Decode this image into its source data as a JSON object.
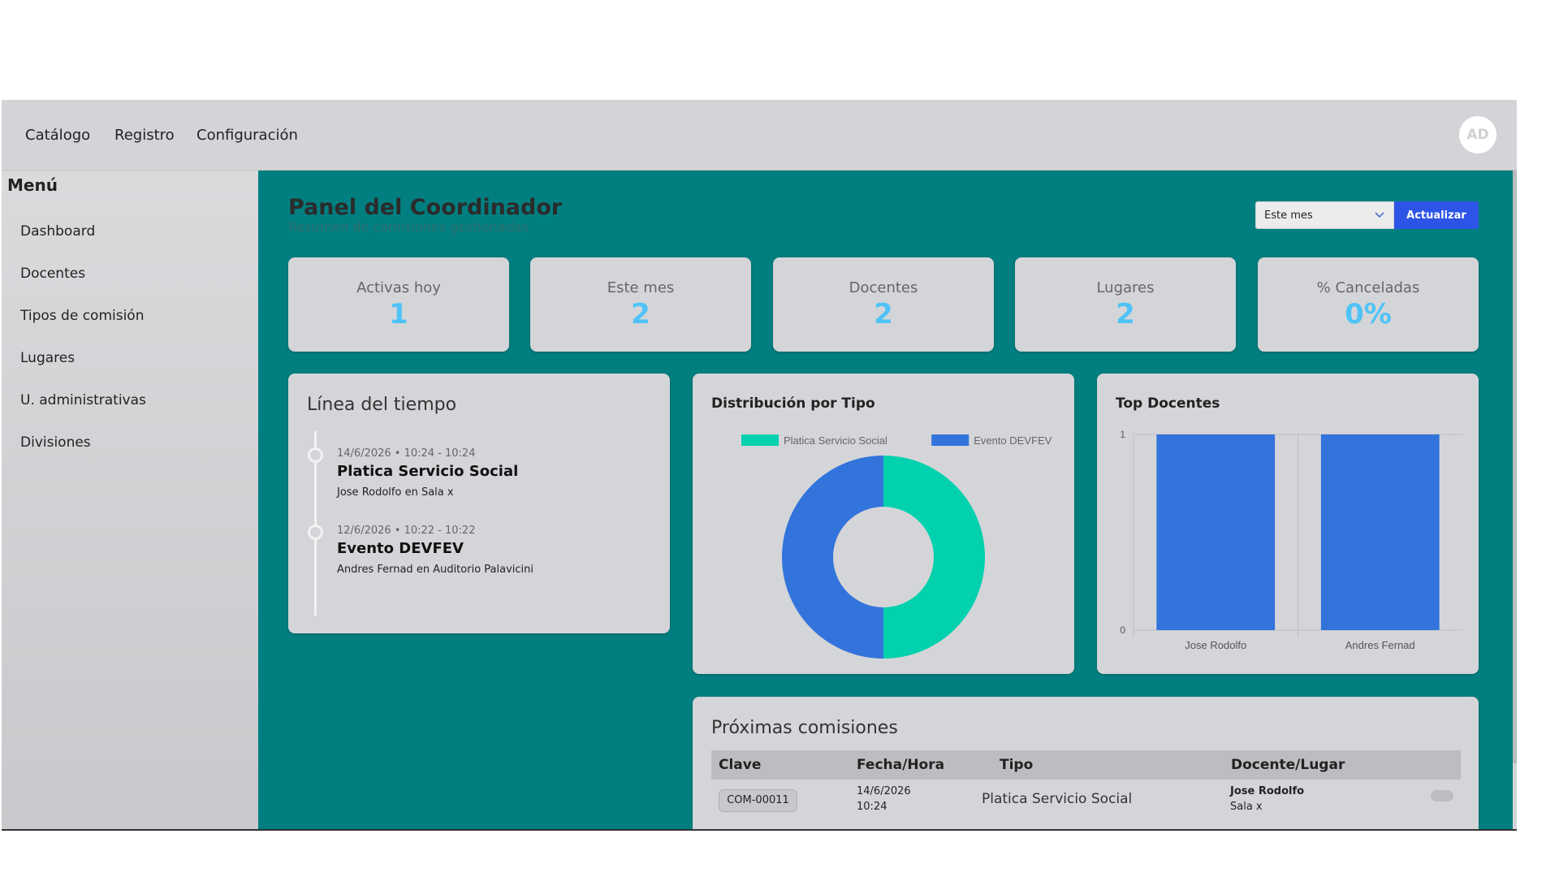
{
  "nav": {
    "items": [
      "Catálogo",
      "Registro",
      "Configuración"
    ],
    "avatar": "AD"
  },
  "sidebar": {
    "title": "Menú",
    "items": [
      "Dashboard",
      "Docentes",
      "Tipos de comisión",
      "Lugares",
      "U. administrativas",
      "Divisiones"
    ]
  },
  "header": {
    "title": "Panel del Coordinador",
    "subtitle": "Resumen de comisiones gestionadas",
    "period": "Este mes",
    "refresh": "Actualizar"
  },
  "kpis": [
    {
      "label": "Activas hoy",
      "value": "1"
    },
    {
      "label": "Este mes",
      "value": "2"
    },
    {
      "label": "Docentes",
      "value": "2"
    },
    {
      "label": "Lugares",
      "value": "2"
    },
    {
      "label": "% Canceladas",
      "value": "0%"
    }
  ],
  "timeline": {
    "title": "Línea del tiempo",
    "events": [
      {
        "date": "14/6/2026 • 10:24 - 10:24",
        "title": "Platica Servicio Social",
        "desc": "Jose Rodolfo en Sala x"
      },
      {
        "date": "12/6/2026 • 10:22 - 10:22",
        "title": "Evento DEVFEV",
        "desc": "Andres Fernad en Auditorio Palavicini"
      }
    ]
  },
  "colors": {
    "teal": "#02d1ae",
    "blue": "#3273dc",
    "kpi_value": "#4fc3f7",
    "background": "#017f80"
  },
  "chart_data": [
    {
      "type": "pie",
      "title": "Distribución por Tipo",
      "categories": [
        "Platica Servicio Social",
        "Evento DEVFEV"
      ],
      "values": [
        1,
        1
      ],
      "colors": [
        "#02d1ae",
        "#3273dc"
      ],
      "legend": "top"
    },
    {
      "type": "bar",
      "title": "Top Docentes",
      "categories": [
        "Jose Rodolfo",
        "Andres Fernad"
      ],
      "values": [
        1,
        1
      ],
      "ylim": [
        0,
        1
      ],
      "yticks": [
        0,
        1
      ],
      "color": "#3273dc",
      "grid": true
    }
  ],
  "table": {
    "title": "Próximas comisiones",
    "headers": [
      "Clave",
      "Fecha/Hora",
      "Tipo",
      "Docente/Lugar"
    ],
    "rows": [
      {
        "clave": "COM-00011",
        "fecha": "14/6/2026",
        "hora": "10:24",
        "tipo": "Platica Servicio Social",
        "docente": "Jose Rodolfo",
        "lugar": "Sala x"
      }
    ]
  }
}
